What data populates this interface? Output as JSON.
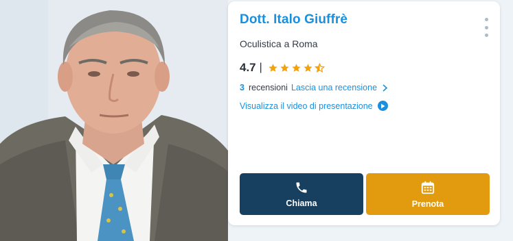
{
  "doctor": {
    "name": "Dott. Italo Giuffrè",
    "specialty": "Oculistica a Roma",
    "rating": "4.7",
    "rating_separator": "|",
    "stars": 4.5,
    "reviews_count": "3",
    "reviews_label": "recensioni",
    "leave_review_label": "Lascia una recensione",
    "video_label": "Visualizza il video di presentazione"
  },
  "actions": {
    "call_label": "Chiama",
    "book_label": "Prenota"
  },
  "colors": {
    "link_blue": "#1a8fdd",
    "call_button": "#173f5f",
    "book_button": "#e29a0e",
    "star": "#f2a20c"
  },
  "icons": {
    "menu": "more-vertical-icon",
    "chevron": "chevron-right-icon",
    "play": "play-circle-icon",
    "phone": "phone-icon",
    "calendar": "calendar-icon"
  }
}
